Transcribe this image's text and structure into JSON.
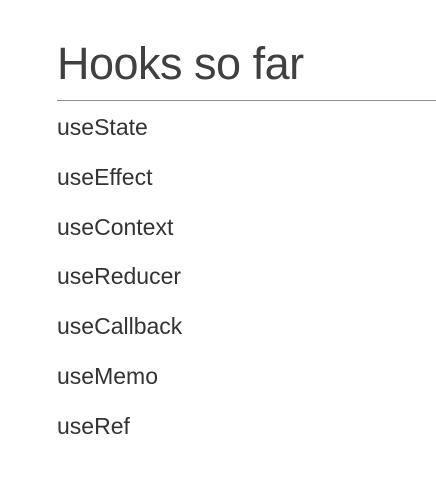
{
  "slide": {
    "title": "Hooks so far",
    "items": [
      "useState",
      "useEffect",
      "useContext",
      "useReducer",
      "useCallback",
      "useMemo",
      "useRef"
    ]
  }
}
